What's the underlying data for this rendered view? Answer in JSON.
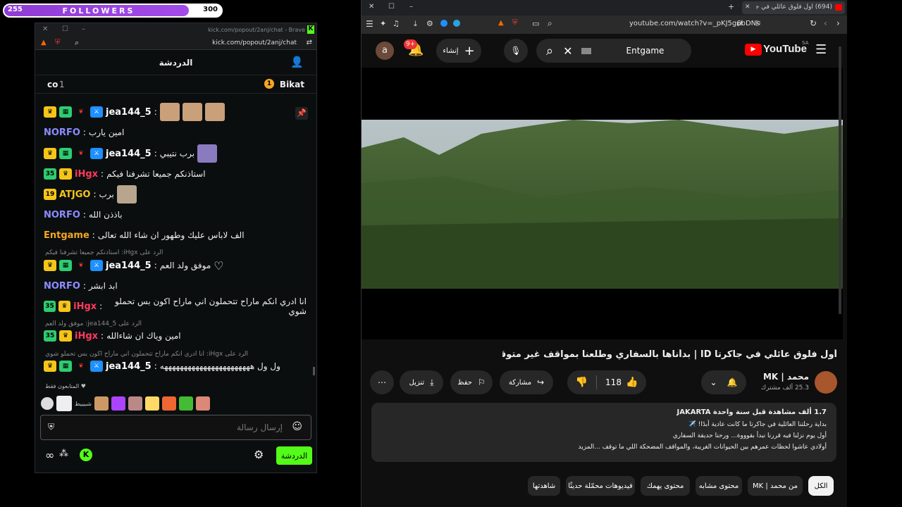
{
  "followers": {
    "current": "255",
    "goal": "300",
    "title": "FOLLOWERS",
    "progress": 0.85
  },
  "kick": {
    "tab_url_short": "kick.com/popout/2anj/chat - Brave",
    "url": "kick.com/popout/2anj/chat",
    "header_title": "الدردشة",
    "pinned_left": "co",
    "pinned_left_count": "1",
    "pinned_right": "Bikat",
    "messages": [
      {
        "user": "jea144_5",
        "text": "",
        "color": "#ffffff"
      },
      {
        "user": "NORFO",
        "text": "امين يارب",
        "color": "#8c8cff"
      },
      {
        "user": "jea144_5",
        "text": "برب نتيبي",
        "color": "#ffffff"
      },
      {
        "user": "iHgx",
        "text": "استاذنكم جميعا تشرفنا فيكم",
        "color": "#ff3b5c",
        "badge": "35"
      },
      {
        "user": "ATJGO",
        "text": "برب",
        "color": "#f5c518",
        "badge": "19"
      },
      {
        "user": "NORFO",
        "text": "باذذن الله",
        "color": "#8c8cff"
      },
      {
        "user": "Entgame",
        "text": "الف لاباس عليك وطهور ان شاء الله تعالى",
        "color": "#f5a623"
      },
      {
        "user": "jea144_5",
        "text": "موفق ولد العم",
        "color": "#ffffff"
      },
      {
        "user": "NORFO",
        "text": "ابد ابشر",
        "color": "#8c8cff"
      },
      {
        "user": "iHgx",
        "text": "انا ادري انكم ماراح تتحملون اني ماراح اكون بس تحملو شوي",
        "color": "#ff3b5c",
        "badge": "35"
      },
      {
        "user": "iHgx",
        "text": "امين وياك ان شاءالله",
        "color": "#ff3b5c",
        "badge": "35"
      },
      {
        "user": "jea144_5",
        "text": "ول ول هههههههههههههههههههههههه",
        "color": "#ffffff"
      }
    ],
    "replies": [
      "الرد على iHgx: استاذنكم جميعا تشرفنا فيكم",
      "الرد على jea144_5: موفق ولد العم",
      "الرد على iHgx: انا ادري انكم ماراح تتحملون اني ماراح اكون بس تحملو شوي"
    ],
    "followers_only": "المتابعون فقط",
    "emote_label": "شبيبيط",
    "input_placeholder": "إرسال رسالة",
    "send_button": "الدردشة"
  },
  "youtube": {
    "tab_title": "(694) أول فلوق عائلي في جاكرتا",
    "url": "youtube.com/watch?v=_pKJ5g6bDNs",
    "search_value": "Entgame",
    "create_label": "إنشاء",
    "notif_count": "9+",
    "avatar_letter": "a",
    "logo_text": "YouTube",
    "logo_region": "SA",
    "video_title": "أول فلوق عائلي في جاكرتا ID | بدأناها بالسفاري وطلعنا بمواقف غير متوقعة!",
    "channel_name": "محمد | MK",
    "subscribers": "25.3 ألف مشترك",
    "likes": "118",
    "share": "مشاركة",
    "save": "حفظ",
    "download": "تنزيل",
    "desc_meta": "1.7 ألف مشاهدة  قبل سنة واحدة  JAKARTA",
    "desc_lines": [
      "بداية رحلتنا العائلية في جاكرتا ما كانت عادية أبدًا! ✈️",
      "أول يوم نزلنا فيه قررنا نبدأ بقوووة... ورحنا حديقة السفاري",
      "أولادي عاشوا لحظات عمرهم بين الحيوانات الغريبة، والمواقف المضحكة اللي ما توقف ...المزيد"
    ],
    "chips": [
      "الكل",
      "من محمد | MK",
      "محتوى مشابه",
      "محتوى يهمك",
      "فيديوهات محمّلة حديثًا",
      "شاهدتها"
    ]
  }
}
